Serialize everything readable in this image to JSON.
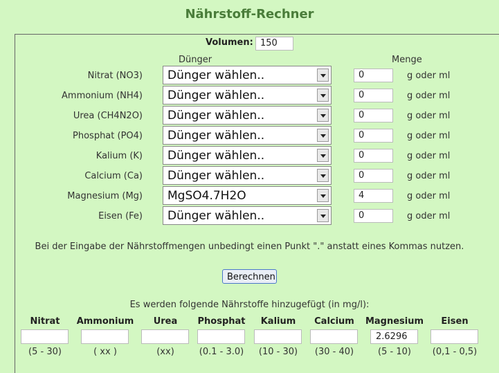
{
  "title": "Nährstoff-Rechner",
  "volume": {
    "label": "Volumen:",
    "value": "150"
  },
  "headers": {
    "fertilizer": "Dünger",
    "amount": "Menge"
  },
  "unit": "g oder ml",
  "rows": [
    {
      "label": "Nitrat (NO3)",
      "selected": "Dünger wählen..",
      "amount": "0"
    },
    {
      "label": "Ammonium (NH4)",
      "selected": "Dünger wählen..",
      "amount": "0"
    },
    {
      "label": "Urea (CH4N2O)",
      "selected": "Dünger wählen..",
      "amount": "0"
    },
    {
      "label": "Phosphat (PO4)",
      "selected": "Dünger wählen..",
      "amount": "0"
    },
    {
      "label": "Kalium (K)",
      "selected": "Dünger wählen..",
      "amount": "0"
    },
    {
      "label": "Calcium (Ca)",
      "selected": "Dünger wählen..",
      "amount": "0"
    },
    {
      "label": "Magnesium (Mg)",
      "selected": "MgSO4.7H2O",
      "amount": "4"
    },
    {
      "label": "Eisen (Fe)",
      "selected": "Dünger wählen..",
      "amount": "0"
    }
  ],
  "note": "Bei der Eingabe der Nährstoffmengen unbedingt einen Punkt \".\" anstatt eines Kommas nutzen.",
  "calculate_label": "Berechnen",
  "results_title": "Es werden folgende Nährstoffe hinzugefügt (in mg/l):",
  "results": [
    {
      "name": "Nitrat",
      "value": "",
      "range": "(5 - 30)"
    },
    {
      "name": "Ammonium",
      "value": "",
      "range": "( xx )"
    },
    {
      "name": "Urea",
      "value": "",
      "range": "(xx)"
    },
    {
      "name": "Phosphat",
      "value": "",
      "range": "(0.1 - 3.0)"
    },
    {
      "name": "Kalium",
      "value": "",
      "range": "(10 - 30)"
    },
    {
      "name": "Calcium",
      "value": "",
      "range": "(30 - 40)"
    },
    {
      "name": "Magnesium",
      "value": "2.6296",
      "range": "(5 - 10)"
    },
    {
      "name": "Eisen",
      "value": "",
      "range": "(0,1 - 0,5)"
    }
  ]
}
